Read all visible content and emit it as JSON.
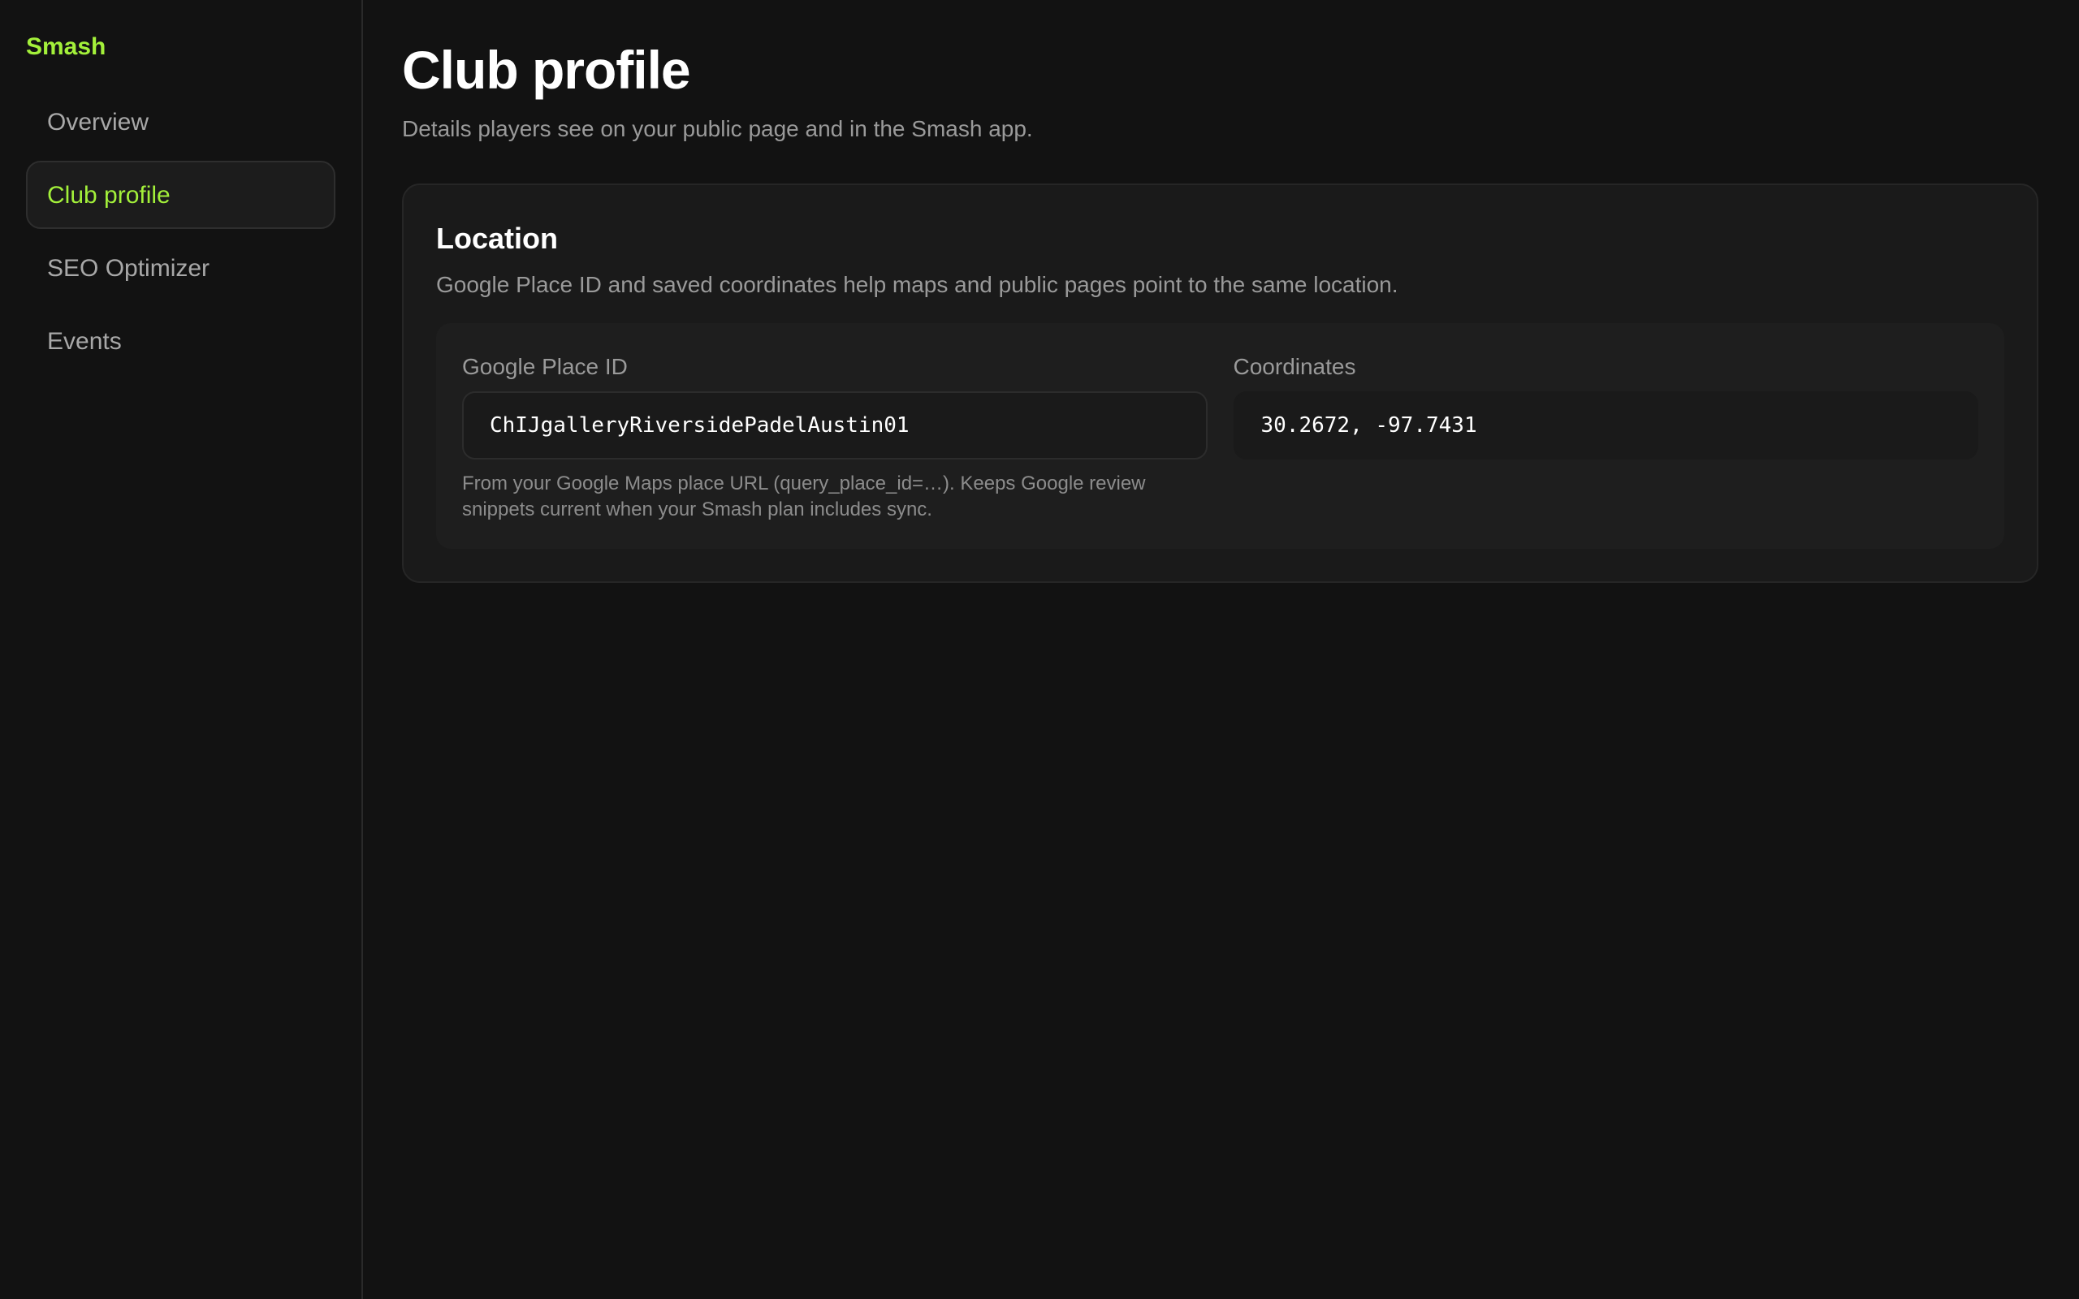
{
  "sidebar": {
    "brand": "Smash",
    "items": [
      {
        "label": "Overview",
        "active": false
      },
      {
        "label": "Club profile",
        "active": true
      },
      {
        "label": "SEO Optimizer",
        "active": false
      },
      {
        "label": "Events",
        "active": false
      }
    ]
  },
  "header": {
    "title": "Club profile",
    "subtitle": "Details players see on your public page and in the Smash app."
  },
  "location": {
    "title": "Location",
    "description": "Google Place ID and saved coordinates help maps and public pages point to the same location.",
    "place_id": {
      "label": "Google Place ID",
      "value": "ChIJgalleryRiversidePadelAustin01",
      "help": "From your Google Maps place URL (query_place_id=…). Keeps Google review snippets current when your Smash plan includes sync."
    },
    "coordinates": {
      "label": "Coordinates",
      "value": "30.2672, -97.7431"
    }
  },
  "colors": {
    "accent": "#a3f03a",
    "background": "#121212",
    "card": "#1a1a1a"
  }
}
